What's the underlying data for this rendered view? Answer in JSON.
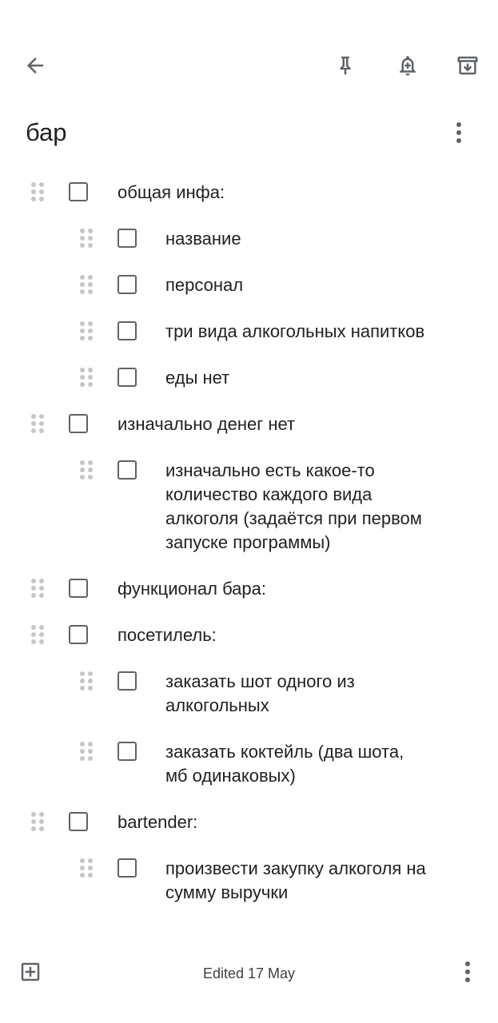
{
  "note": {
    "title": "бар",
    "edited": "Edited 17 May"
  },
  "toolbar": {
    "back_icon": "arrow-back-icon",
    "pin_icon": "pin-icon",
    "reminder_icon": "add-alert-icon",
    "archive_icon": "archive-icon"
  },
  "items": [
    {
      "text": "общая инфа:",
      "level": 0,
      "checked": false
    },
    {
      "text": "название",
      "level": 1,
      "checked": false
    },
    {
      "text": "персонал",
      "level": 1,
      "checked": false
    },
    {
      "text": "три вида алкогольных напитков",
      "level": 1,
      "checked": false
    },
    {
      "text": "еды нет",
      "level": 1,
      "checked": false
    },
    {
      "text": "изначально денег нет",
      "level": 0,
      "checked": false
    },
    {
      "text": "изначально есть какое-то количество каждого вида алкоголя (задаётся при первом запуске программы)",
      "level": 1,
      "checked": false
    },
    {
      "text": "функционал бара:",
      "level": 0,
      "checked": false
    },
    {
      "text": "посетилель:",
      "level": 0,
      "checked": false
    },
    {
      "text": "заказать шот одного из алкогольных",
      "level": 1,
      "checked": false
    },
    {
      "text": "заказать коктейль (два шота, мб одинаковых)",
      "level": 1,
      "checked": false
    },
    {
      "text": "bartender:",
      "level": 0,
      "checked": false
    },
    {
      "text": "произвести закупку алкоголя на сумму выручки",
      "level": 1,
      "checked": false
    }
  ],
  "colors": {
    "icon": "#5f6368",
    "text": "#202124",
    "handle": "#c4c7c5",
    "background": "#ffffff"
  }
}
